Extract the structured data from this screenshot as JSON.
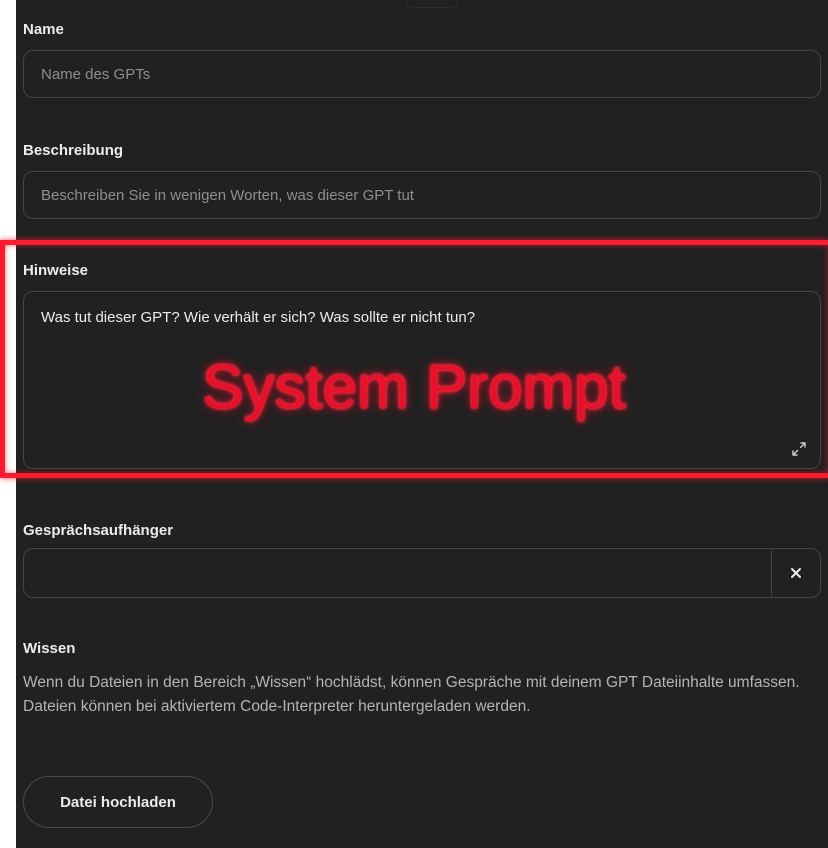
{
  "name": {
    "label": "Name",
    "placeholder": "Name des GPTs"
  },
  "description": {
    "label": "Beschreibung",
    "placeholder": "Beschreiben Sie in wenigen Worten, was dieser GPT tut"
  },
  "instructions": {
    "label": "Hinweise",
    "placeholder": "Was tut dieser GPT? Wie verhält er sich? Was sollte er nicht tun?",
    "expand_icon": "expand-icon"
  },
  "annotation": {
    "text": "System Prompt",
    "color": "#ff1a2e"
  },
  "conversation_starters": {
    "label": "Gesprächsaufhänger",
    "value": "",
    "remove_icon": "close-icon"
  },
  "knowledge": {
    "label": "Wissen",
    "description": "Wenn du Dateien in den Bereich „Wissen“ hochlädst, können Gespräche mit deinem GPT Dateiinhalte umfassen. Dateien können bei aktiviertem Code-Interpreter heruntergeladen werden.",
    "upload_label": "Datei hochladen"
  },
  "colors": {
    "background": "#212121",
    "border": "#444444",
    "text": "#ececec",
    "placeholder": "#8e8e8e",
    "highlight": "#ff1a2e"
  }
}
